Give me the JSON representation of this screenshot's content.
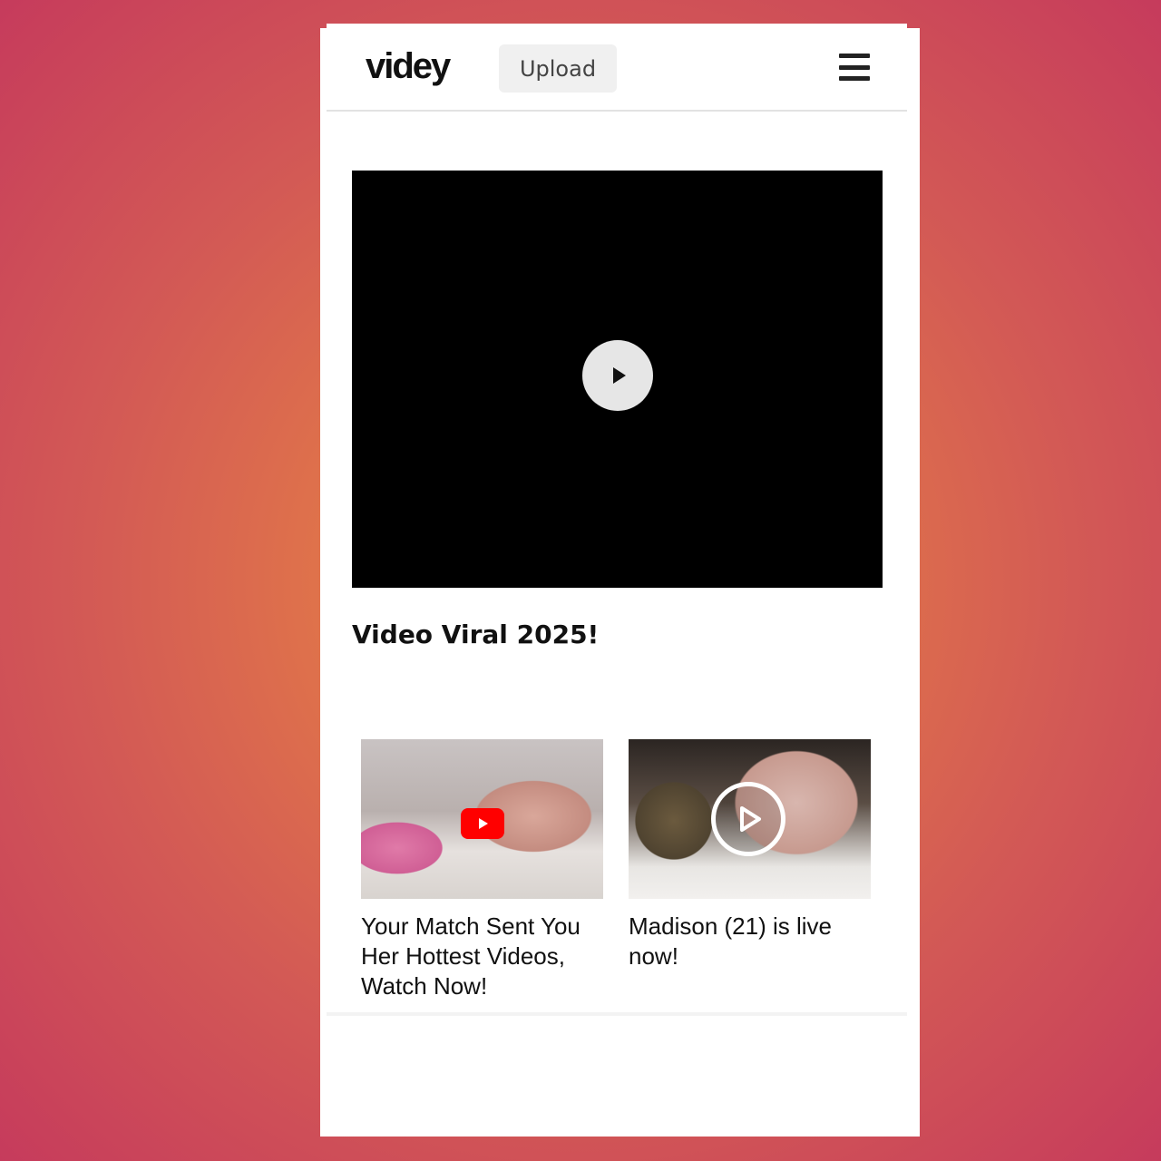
{
  "header": {
    "logo": "videy",
    "upload_label": "Upload"
  },
  "video": {
    "title": "Video Viral 2025!"
  },
  "ads": [
    {
      "text": "Your Match Sent You Her Hottest Videos, Watch Now!",
      "badge_icon": "youtube-play-icon"
    },
    {
      "text": "Madison (21) is live now!",
      "badge_icon": "circle-play-icon"
    }
  ],
  "colors": {
    "background_center": "#e88a45",
    "background_edge": "#c63b5c",
    "player": "#000000",
    "youtube_red": "#ff0000"
  }
}
